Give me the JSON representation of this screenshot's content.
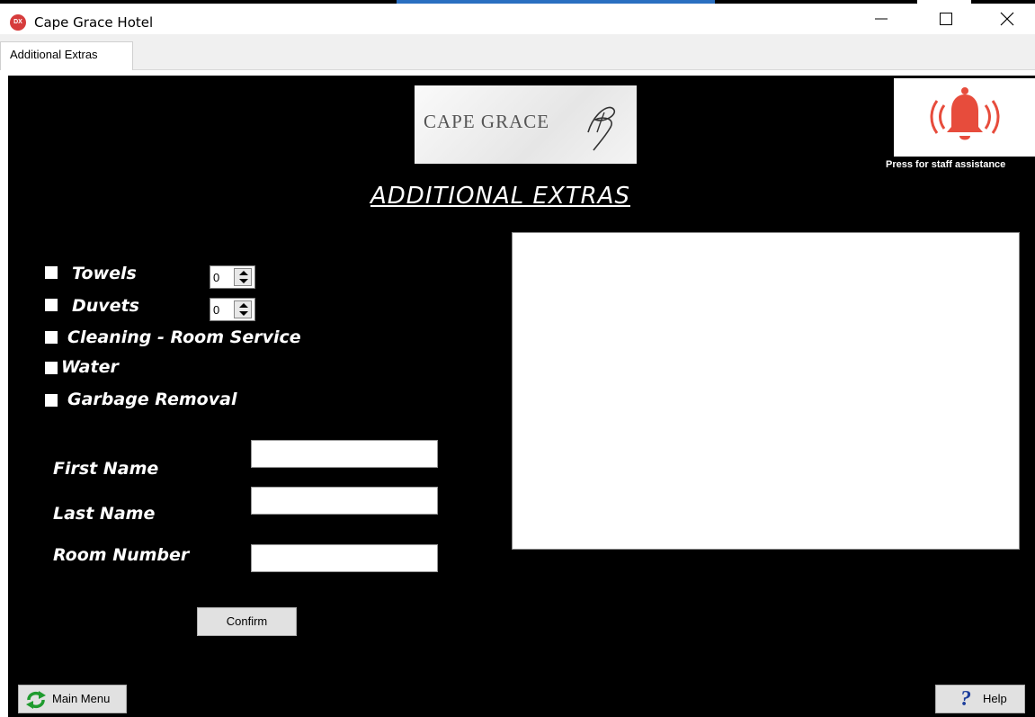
{
  "window": {
    "title": "Cape Grace Hotel",
    "icon_text": "DX"
  },
  "tabs": [
    {
      "label": "Additional Extras"
    }
  ],
  "logo": {
    "brand": "CAPE GRACE"
  },
  "assistance": {
    "caption": "Press for staff assistance"
  },
  "page": {
    "heading": "ADDITIONAL EXTRAS"
  },
  "extras": {
    "towels": {
      "label": "Towels",
      "quantity": "0",
      "checked": false
    },
    "duvets": {
      "label": "Duvets",
      "quantity": "0",
      "checked": false
    },
    "cleaning": {
      "label": "Cleaning - Room Service",
      "checked": false
    },
    "water": {
      "label": "Water",
      "checked": false
    },
    "garbage": {
      "label": "Garbage Removal",
      "checked": false
    }
  },
  "form": {
    "first_name_label": "First Name",
    "first_name_value": "",
    "last_name_label": "Last Name",
    "last_name_value": "",
    "room_number_label": "Room Number",
    "room_number_value": ""
  },
  "buttons": {
    "confirm": "Confirm",
    "main_menu": "Main Menu",
    "help": "Help"
  },
  "colors": {
    "panel_bg": "#000000",
    "bell": "#e74c3c",
    "help_icon": "#1d3e9c"
  }
}
